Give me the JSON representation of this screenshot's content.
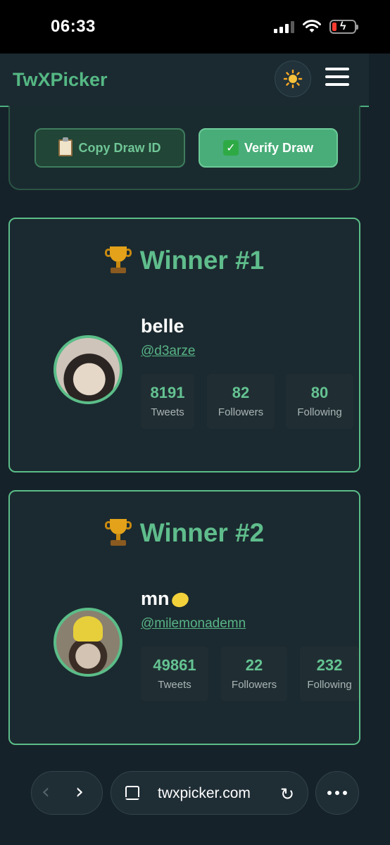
{
  "status": {
    "time": "06:33"
  },
  "header": {
    "brand": "TwXPicker"
  },
  "actions": {
    "copy_label": "Copy Draw ID",
    "verify_label": "Verify Draw"
  },
  "winners": [
    {
      "title": "Winner #1",
      "name": "belle",
      "handle": "@d3arze",
      "stats": [
        {
          "value": "8191",
          "label": "Tweets"
        },
        {
          "value": "82",
          "label": "Followers"
        },
        {
          "value": "80",
          "label": "Following"
        }
      ]
    },
    {
      "title": "Winner #2",
      "name": "mn",
      "handle": "@milemonademn",
      "stats": [
        {
          "value": "49861",
          "label": "Tweets"
        },
        {
          "value": "22",
          "label": "Followers"
        },
        {
          "value": "232",
          "label": "Following"
        }
      ]
    }
  ],
  "browser": {
    "url": "twxpicker.com"
  },
  "icons": [
    "signal-icon",
    "wifi-icon",
    "battery-icon",
    "sun-icon",
    "menu-icon",
    "clipboard-icon",
    "checkmark-icon",
    "trophy-icon",
    "lemon-icon",
    "back-icon",
    "forward-icon",
    "tabs-icon",
    "reload-icon",
    "more-icon"
  ]
}
